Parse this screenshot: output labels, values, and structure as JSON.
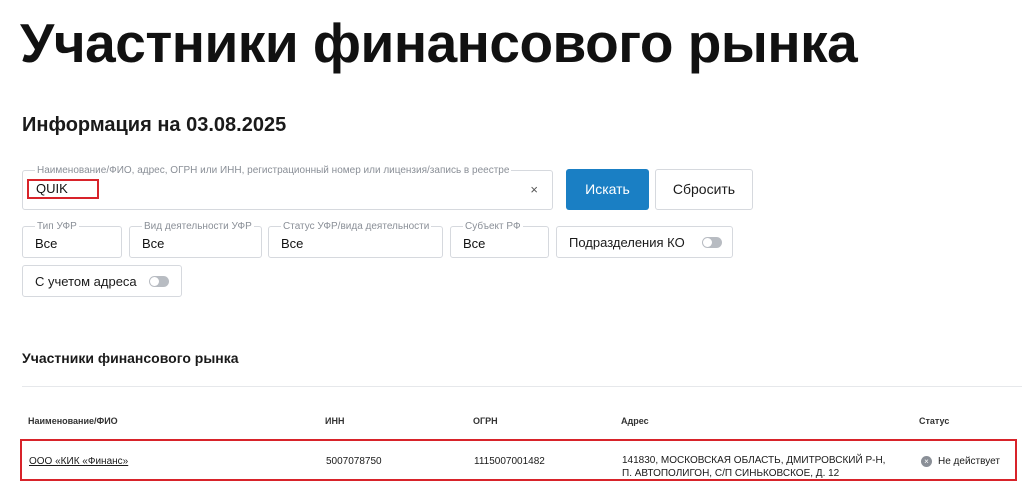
{
  "page": {
    "title": "Участники финансового рынка",
    "info_date": "Информация на 03.08.2025"
  },
  "search": {
    "label": "Наименование/ФИО, адрес, ОГРН или ИНН, регистрационный номер или лицензия/запись в реестре",
    "value": "QUIK",
    "clear_glyph": "×",
    "search_button": "Искать",
    "reset_button": "Сбросить"
  },
  "filters": {
    "type": {
      "label": "Тип УФР",
      "value": "Все"
    },
    "kind": {
      "label": "Вид деятельности УФР",
      "value": "Все"
    },
    "status": {
      "label": "Статус УФР/вида деятельности",
      "value": "Все"
    },
    "subject": {
      "label": "Субъект РФ",
      "value": "Все"
    },
    "ko_divisions": {
      "label": "Подразделения КО",
      "enabled": false
    },
    "with_address": {
      "label": "С учетом адреса",
      "enabled": false
    }
  },
  "results": {
    "section_title": "Участники финансового рынка",
    "columns": [
      "Наименование/ФИО",
      "ИНН",
      "ОГРН",
      "Адрес",
      "Статус"
    ],
    "rows": [
      {
        "name": "ООО «КИК «Финанс»",
        "inn": "5007078750",
        "ogrn": "1115007001482",
        "address_line1": "141830, Московская область, Дмитровский р-н,",
        "address_line2": "п. Автополигон, с/п Синьковское, д. 12",
        "status": "Не действует",
        "status_icon": "close-circle-icon"
      }
    ]
  },
  "colors": {
    "accent": "#1a7fc4",
    "highlight": "#d8232a"
  }
}
